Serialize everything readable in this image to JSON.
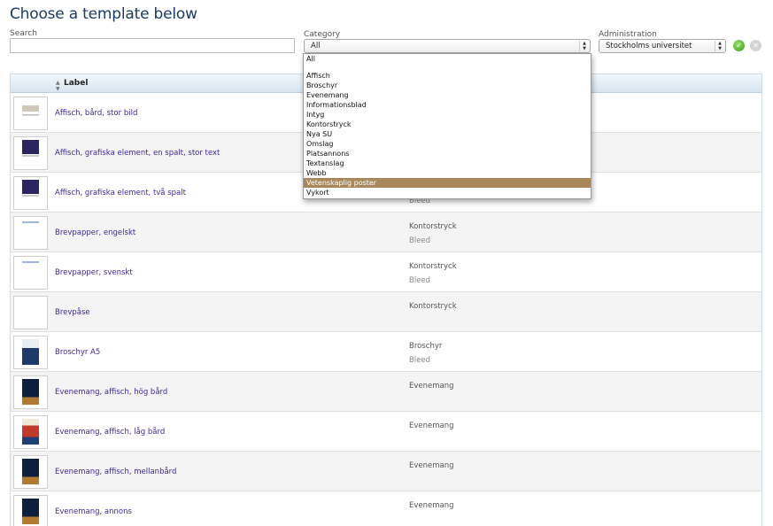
{
  "page": {
    "title": "Choose a template below"
  },
  "filters": {
    "search_label": "Search",
    "search_value": "",
    "category_label": "Category",
    "category_value": "All",
    "administration_label": "Administration",
    "administration_value": "Stockholms universitet"
  },
  "table": {
    "header_label": "Label",
    "rows": [
      {
        "label": "Affisch, bård, stor bild",
        "category": "",
        "sub": "",
        "thumb": "print"
      },
      {
        "label": "Affisch, grafiska element, en spalt, stor text",
        "category": "",
        "sub": "",
        "thumb": "dark"
      },
      {
        "label": "Affisch, grafiska element, två spalt",
        "category": "",
        "sub": "Bleed",
        "thumb": "dark"
      },
      {
        "label": "Brevpapper, engelskt",
        "category": "Kontorstryck",
        "sub": "Bleed",
        "thumb": "letter"
      },
      {
        "label": "Brevpapper, svenskt",
        "category": "Kontorstryck",
        "sub": "Bleed",
        "thumb": "letter"
      },
      {
        "label": "Brevpåse",
        "category": "Kontorstryck",
        "sub": "",
        "thumb": "blank"
      },
      {
        "label": "Broschyr A5",
        "category": "Broschyr",
        "sub": "Bleed",
        "thumb": "photo"
      },
      {
        "label": "Evenemang, affisch, hög bård",
        "category": "Evenemang",
        "sub": "",
        "thumb": "portrait"
      },
      {
        "label": "Evenemang, affisch, låg bård",
        "category": "Evenemang",
        "sub": "",
        "thumb": "red"
      },
      {
        "label": "Evenemang, affisch, mellanbård",
        "category": "Evenemang",
        "sub": "",
        "thumb": "portrait"
      },
      {
        "label": "Evenemang, annons",
        "category": "Evenemang",
        "sub": "",
        "thumb": "portrait"
      }
    ]
  },
  "category_dropdown": {
    "options": [
      "All",
      "",
      "Affisch",
      "Broschyr",
      "Evenemang",
      "Informationsblad",
      "Intyg",
      "Kontorstryck",
      "Nya SU",
      "Omslag",
      "Platsannons",
      "Textanslag",
      "Webb",
      "Vetenskaplig poster",
      "Vykort"
    ],
    "highlighted": "Vetenskaplig poster",
    "highlight_color": "#a8885a"
  },
  "colors": {
    "title": "#1e3a66",
    "link": "#3c2a9c",
    "accent_green": "#3f9a1c"
  },
  "icons": {
    "ok": "check-circle-icon",
    "clear": "clear-circle-icon",
    "sort": "sort-arrows-icon"
  }
}
